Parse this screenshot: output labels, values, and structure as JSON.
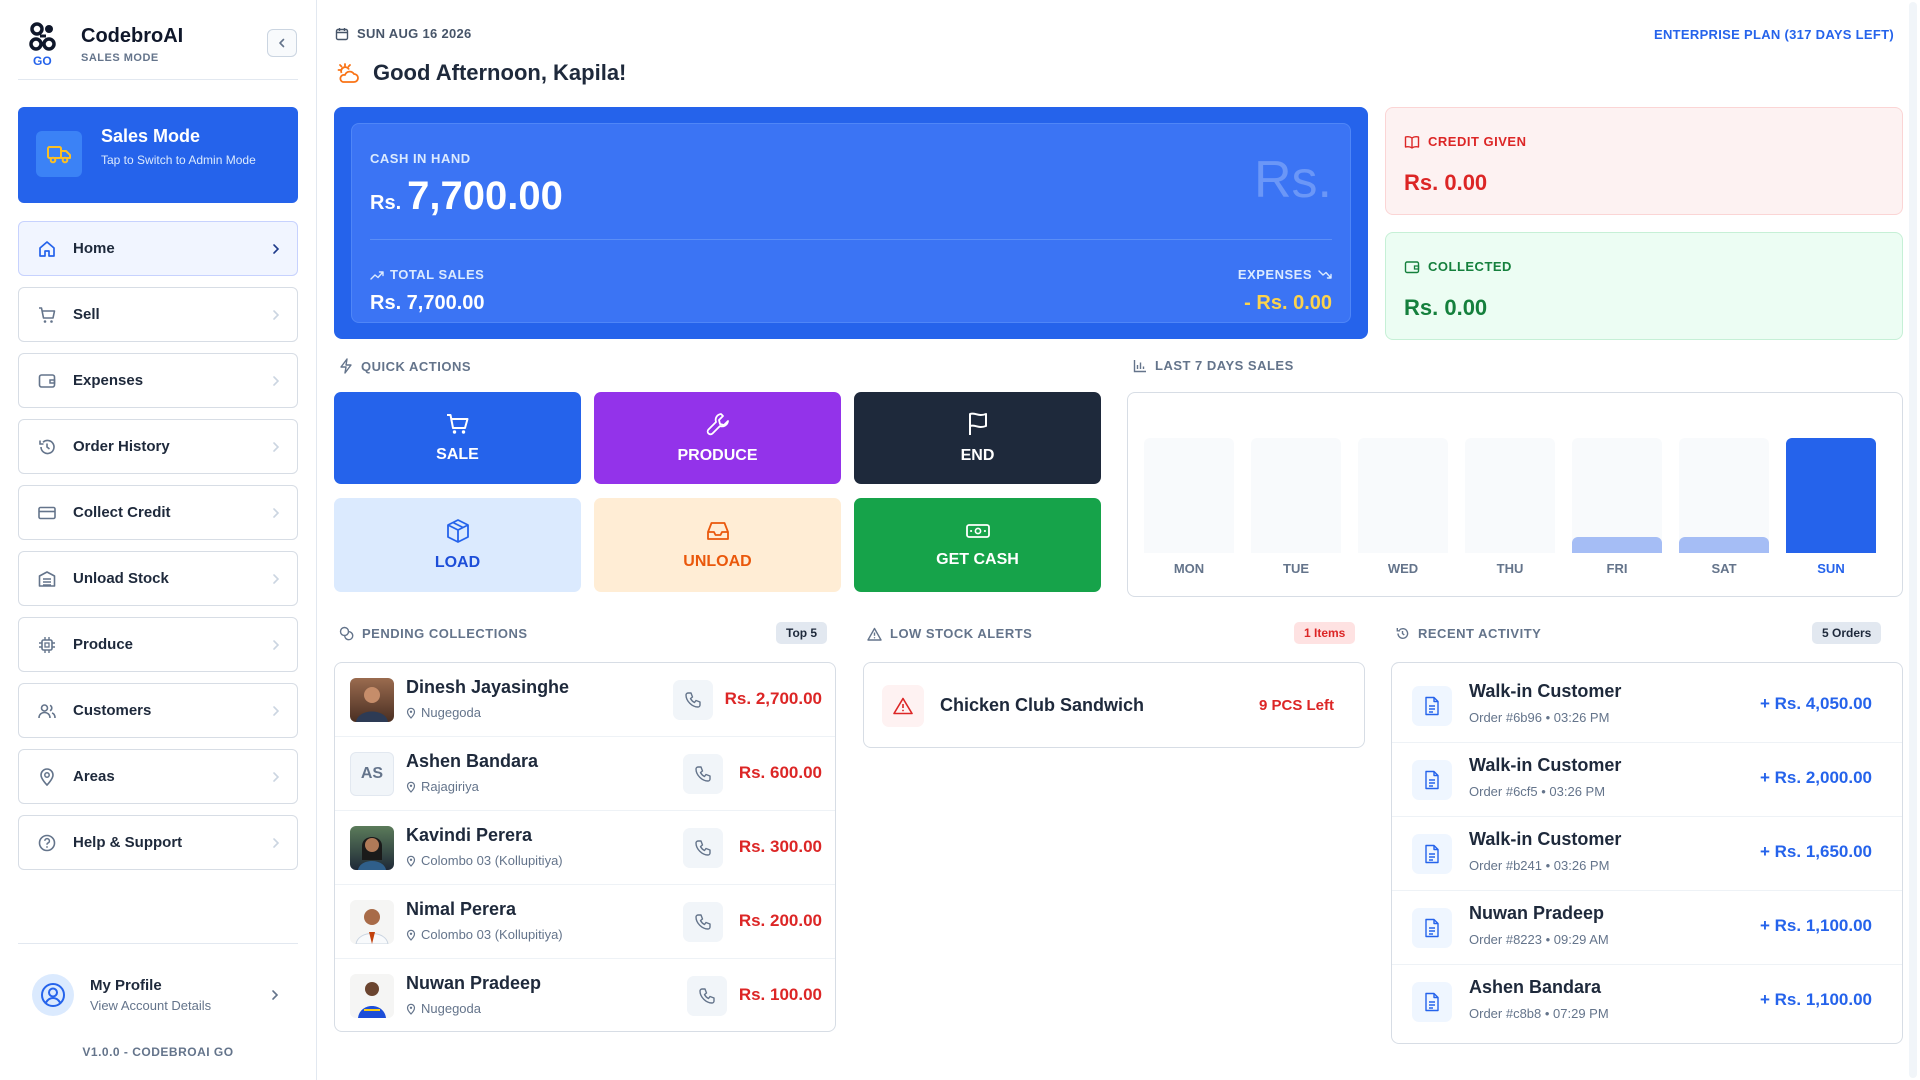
{
  "brand": {
    "name": "CodebroAI",
    "subtitle": "SALES MODE",
    "logo_tag": "GO"
  },
  "mode_card": {
    "title": "Sales Mode",
    "subtitle": "Tap to Switch to Admin Mode"
  },
  "nav": [
    {
      "label": "Home",
      "icon": "home-icon"
    },
    {
      "label": "Sell",
      "icon": "cart-icon"
    },
    {
      "label": "Expenses",
      "icon": "wallet-icon"
    },
    {
      "label": "Order History",
      "icon": "history-icon"
    },
    {
      "label": "Collect Credit",
      "icon": "credit-card-icon"
    },
    {
      "label": "Unload Stock",
      "icon": "warehouse-icon"
    },
    {
      "label": "Produce",
      "icon": "chip-icon"
    },
    {
      "label": "Customers",
      "icon": "users-icon"
    },
    {
      "label": "Areas",
      "icon": "map-pin-icon"
    },
    {
      "label": "Help & Support",
      "icon": "help-icon"
    }
  ],
  "profile": {
    "name": "My Profile",
    "subtitle": "View Account Details"
  },
  "version": "V1.0.0 - CODEBROAI GO",
  "header": {
    "date": "SUN AUG 16 2026",
    "plan": "ENTERPRISE PLAN (317 DAYS LEFT)",
    "greeting": "Good Afternoon, Kapila!"
  },
  "cash": {
    "label": "CASH IN HAND",
    "currency": "Rs.",
    "amount": "7,700.00",
    "watermark": "Rs.",
    "total_sales_label": "TOTAL SALES",
    "total_sales_value": "Rs. 7,700.00",
    "expenses_label": "EXPENSES",
    "expenses_value": "- Rs. 0.00"
  },
  "credit": {
    "label": "CREDIT GIVEN",
    "value": "Rs. 0.00"
  },
  "collected": {
    "label": "COLLECTED",
    "value": "Rs. 0.00"
  },
  "quick_actions": {
    "title": "QUICK ACTIONS",
    "items": [
      {
        "label": "SALE"
      },
      {
        "label": "PRODUCE"
      },
      {
        "label": "END"
      },
      {
        "label": "LOAD"
      },
      {
        "label": "UNLOAD"
      },
      {
        "label": "GET CASH"
      }
    ]
  },
  "chart_title": "LAST 7 DAYS SALES",
  "chart_data": {
    "type": "bar",
    "categories": [
      "MON",
      "TUE",
      "WED",
      "THU",
      "FRI",
      "SAT",
      "SUN"
    ],
    "values": [
      0,
      0,
      0,
      0,
      1100,
      1100,
      7700
    ],
    "ylim": [
      0,
      7700
    ],
    "highlight_color": "#2563eb",
    "muted_color": "#a5bdf5"
  },
  "pending": {
    "title": "PENDING COLLECTIONS",
    "badge": "Top 5",
    "rows": [
      {
        "name": "Dinesh Jayasinghe",
        "location": "Nugegoda",
        "amount": "Rs. 2,700.00"
      },
      {
        "name": "Ashen Bandara",
        "location": "Rajagiriya",
        "amount": "Rs. 600.00",
        "initials": "AS"
      },
      {
        "name": "Kavindi Perera",
        "location": "Colombo 03 (Kollupitiya)",
        "amount": "Rs. 300.00"
      },
      {
        "name": "Nimal Perera",
        "location": "Colombo 03 (Kollupitiya)",
        "amount": "Rs. 200.00"
      },
      {
        "name": "Nuwan Pradeep",
        "location": "Nugegoda",
        "amount": "Rs. 100.00"
      }
    ]
  },
  "low_stock": {
    "title": "LOW STOCK ALERTS",
    "badge": "1 Items",
    "items": [
      {
        "name": "Chicken Club Sandwich",
        "left": "9 PCS Left"
      }
    ]
  },
  "recent": {
    "title": "RECENT ACTIVITY",
    "badge": "5 Orders",
    "rows": [
      {
        "name": "Walk-in Customer",
        "meta": "Order #6b96 • 03:26 PM",
        "amount": "+ Rs. 4,050.00"
      },
      {
        "name": "Walk-in Customer",
        "meta": "Order #6cf5 • 03:26 PM",
        "amount": "+ Rs. 2,000.00"
      },
      {
        "name": "Walk-in Customer",
        "meta": "Order #b241 • 03:26 PM",
        "amount": "+ Rs. 1,650.00"
      },
      {
        "name": "Nuwan Pradeep",
        "meta": "Order #8223 • 09:29 AM",
        "amount": "+ Rs. 1,100.00"
      },
      {
        "name": "Ashen Bandara",
        "meta": "Order #c8b8 • 07:29 PM",
        "amount": "+ Rs. 1,100.00"
      }
    ]
  }
}
